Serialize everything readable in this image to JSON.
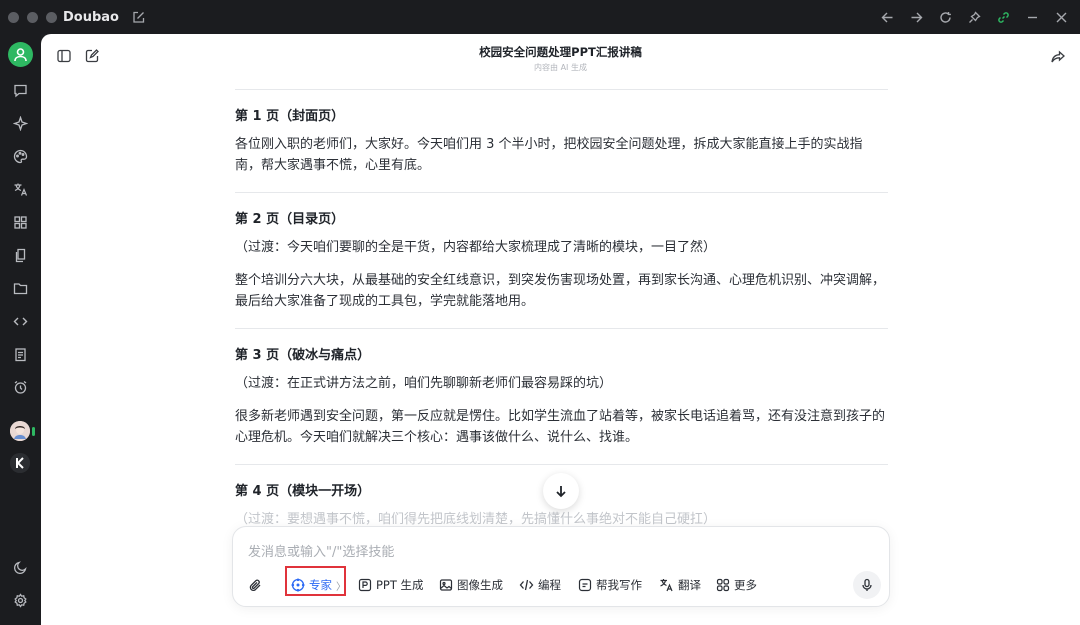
{
  "app": {
    "name": "Doubao"
  },
  "doc": {
    "title": "校园安全问题处理PPT汇报讲稿",
    "subtitle": "内容由 AI 生成"
  },
  "sections": [
    {
      "title": "第 1 页（封面页）",
      "paras": [
        "各位刚入职的老师们，大家好。今天咱们用 3 个半小时，把校园安全问题处理，拆成大家能直接上手的实战指南，帮大家遇事不慌，心里有底。"
      ]
    },
    {
      "title": "第 2 页（目录页）",
      "paras": [
        "（过渡：今天咱们要聊的全是干货，内容都给大家梳理成了清晰的模块，一目了然）",
        "整个培训分六大块，从最基础的安全红线意识，到突发伤害现场处置，再到家长沟通、心理危机识别、冲突调解，最后给大家准备了现成的工具包，学完就能落地用。"
      ]
    },
    {
      "title": "第 3 页（破冰与痛点）",
      "paras": [
        "（过渡：在正式讲方法之前，咱们先聊聊新老师们最容易踩的坑）",
        "很多新老师遇到安全问题，第一反应就是愣住。比如学生流血了站着等，被家长电话追着骂，还有没注意到孩子的心理危机。今天咱们就解决三个核心：遇事该做什么、说什么、找谁。"
      ]
    },
    {
      "title": "第 4 页（模块一开场）",
      "paras": [
        "（过渡：要想遇事不慌，咱们得先把底线划清楚，先搞懂什么事绝对不能自己硬扛）"
      ]
    }
  ],
  "input": {
    "placeholder": "发消息或输入\"/\"选择技能",
    "tools": {
      "expert": "专家",
      "ppt": "PPT 生成",
      "image": "图像生成",
      "code": "编程",
      "write": "帮我写作",
      "translate": "翻译",
      "more": "更多"
    }
  },
  "colors": {
    "accent": "#2d6af4",
    "highlight": "#e0333b",
    "online": "#2eb862"
  }
}
